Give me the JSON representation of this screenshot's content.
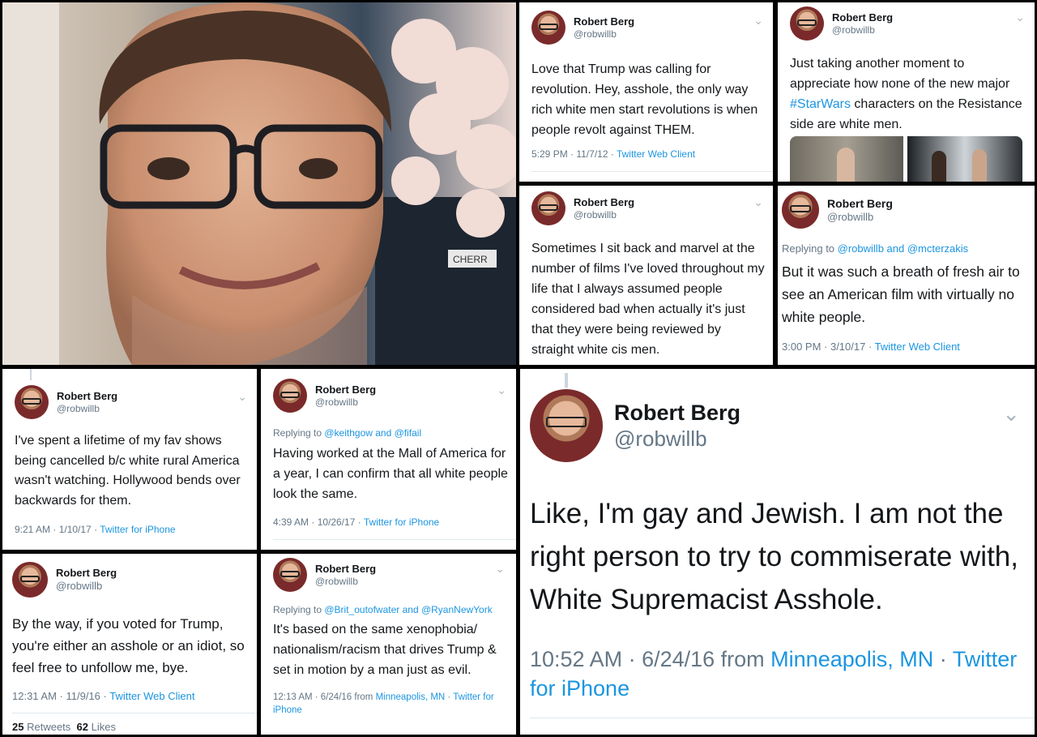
{
  "accent_color": "#1b95e0",
  "muted_color": "#657786",
  "tweets": [
    {
      "name": "Robert Berg",
      "handle": "@robwillb",
      "text": "Love that Trump was calling for revolution. Hey, asshole, the only way rich white men start revolutions is when people revolt against THEM.",
      "time": "5:29 PM · 11/7/12 · ",
      "client": "Twitter Web Client"
    },
    {
      "name": "Robert Berg",
      "handle": "@robwillb",
      "text_before": "Just taking another moment to appreciate how none of the new major ",
      "hashtag": "#StarWars",
      "text_after": " characters on the Resistance side are white men."
    },
    {
      "name": "Robert Berg",
      "handle": "@robwillb",
      "text": "Sometimes I sit back and marvel at the number of films I've loved throughout my life that I always assumed people considered bad when actually it's just that they were being reviewed by straight white cis men."
    },
    {
      "name": "Robert Berg",
      "handle": "@robwillb",
      "reply_prefix": "Replying to ",
      "reply_users": "@robwillb and @mcterzakis",
      "text": "But it was such a breath of fresh air to see an American film with virtually no white people.",
      "time": "3:00 PM · 3/10/17 · ",
      "client": "Twitter Web Client"
    },
    {
      "name": "Robert Berg",
      "handle": "@robwillb",
      "text": "I've spent a lifetime of my fav shows being cancelled b/c white rural America wasn't watching. Hollywood bends over backwards for them.",
      "time": "9:21 AM · 1/10/17 · ",
      "client": "Twitter for iPhone"
    },
    {
      "name": "Robert Berg",
      "handle": "@robwillb",
      "reply_prefix": "Replying to ",
      "reply_users": "@keithgow and @fifail",
      "text": "Having worked at the Mall of America for a year, I can confirm that all white people look the same.",
      "time": "4:39 AM · 10/26/17 · ",
      "client": "Twitter for iPhone"
    },
    {
      "name": "Robert Berg",
      "handle": "@robwillb",
      "text": "By the way, if you voted for Trump, you're either an asshole or an idiot, so feel free to unfollow me, bye.",
      "time": "12:31 AM · 11/9/16 · ",
      "client": "Twitter Web Client",
      "retweets": "25",
      "retweets_label": "Retweets",
      "likes": "62",
      "likes_label": "Likes"
    },
    {
      "name": "Robert Berg",
      "handle": "@robwillb",
      "reply_prefix": "Replying to ",
      "reply_users": "@Brit_outofwater and @RyanNewYork",
      "text": "It's based on the same xenophobia/ nationalism/racism that drives Trump & set in motion by a man just as evil.",
      "time": "12:13 AM · 6/24/16 from ",
      "location": "Minneapolis, MN",
      "sep": " · ",
      "client": "Twitter for iPhone"
    },
    {
      "name": "Robert Berg",
      "handle": "@robwillb",
      "text": "Like, I'm gay and Jewish. I am not the right person to try to commiserate with, White Supremacist Asshole.",
      "time": "10:52 AM · 6/24/16 from ",
      "location": "Minneapolis, MN",
      "sep": " · ",
      "client": "Twitter for iPhone"
    }
  ],
  "photo_sign": "CHERR"
}
